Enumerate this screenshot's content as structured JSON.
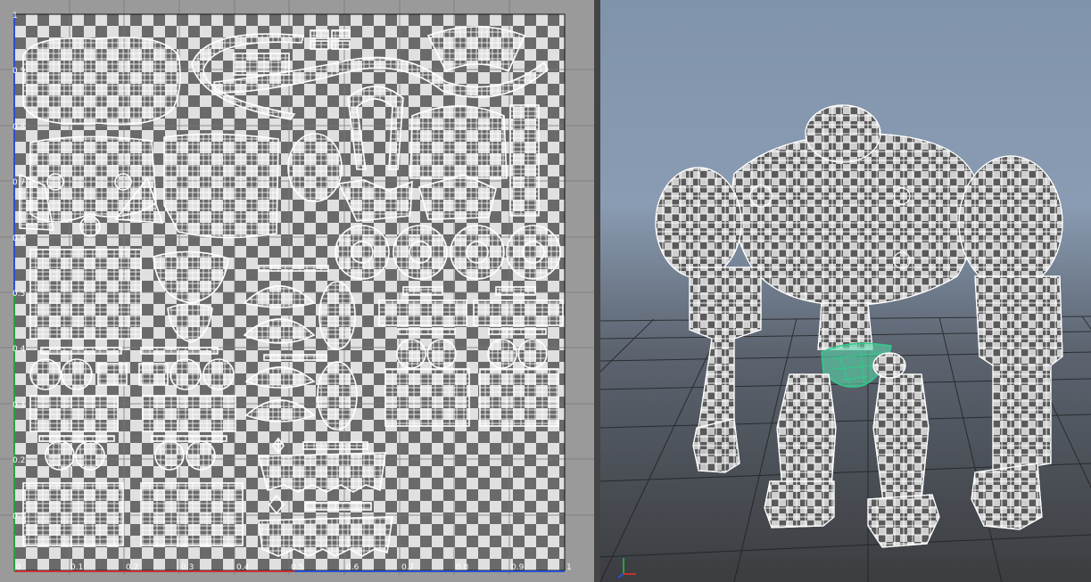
{
  "uv_editor": {
    "axis_labels_x": [
      "0",
      "0.1",
      "0.2",
      "0.3",
      "0.4",
      "0.5",
      "0.6",
      "0.7",
      "0.8",
      "0.9",
      "1"
    ],
    "axis_labels_y": [
      "1",
      "0.9",
      "0.8",
      "0.7",
      "0.6",
      "0.5",
      "0.4",
      "0.3",
      "0.2",
      "0.1"
    ],
    "checker_light": "#e0e0e0",
    "checker_dark": "#6a6a6a",
    "uv_wire_color": "#ffffff"
  },
  "viewport": {
    "grid_color": "#1c1c1c",
    "model_wire_color": "#ffffff",
    "selection_color": "#2ecc8a",
    "axis_icon": "xyz-axis-icon"
  }
}
